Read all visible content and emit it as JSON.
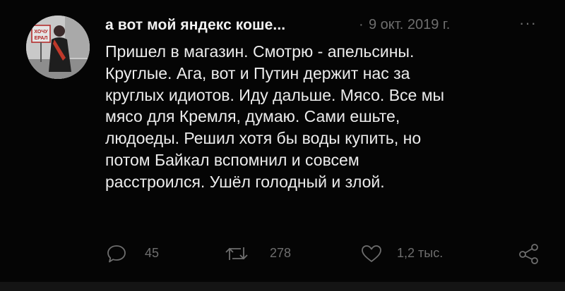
{
  "tweet": {
    "author_name": "а вот мой яндекс коше...",
    "separator": "·",
    "date": "9 окт. 2019 г.",
    "more_label": "···",
    "avatar_sign_text": "ХОЧУ ЕРАЛ",
    "text_lines": [
      "Пришел в магазин. Смотрю - апельсины.",
      "Круглые. Ага, вот и Путин держит нас за",
      "круглых идиотов. Иду дальше. Мясо. Все мы",
      "мясо для Кремля, думаю. Сами ешьте,",
      "людоеды. Решил хотя бы воды купить, но",
      "потом Байкал вспомнил и совсем",
      "расстроился. Ушёл голодный и злой."
    ]
  },
  "actions": {
    "reply_count": "45",
    "retweet_count": "278",
    "like_count": "1,2 тыс."
  },
  "colors": {
    "background": "#050505",
    "text": "#ececec",
    "muted": "#6e6e6e"
  }
}
